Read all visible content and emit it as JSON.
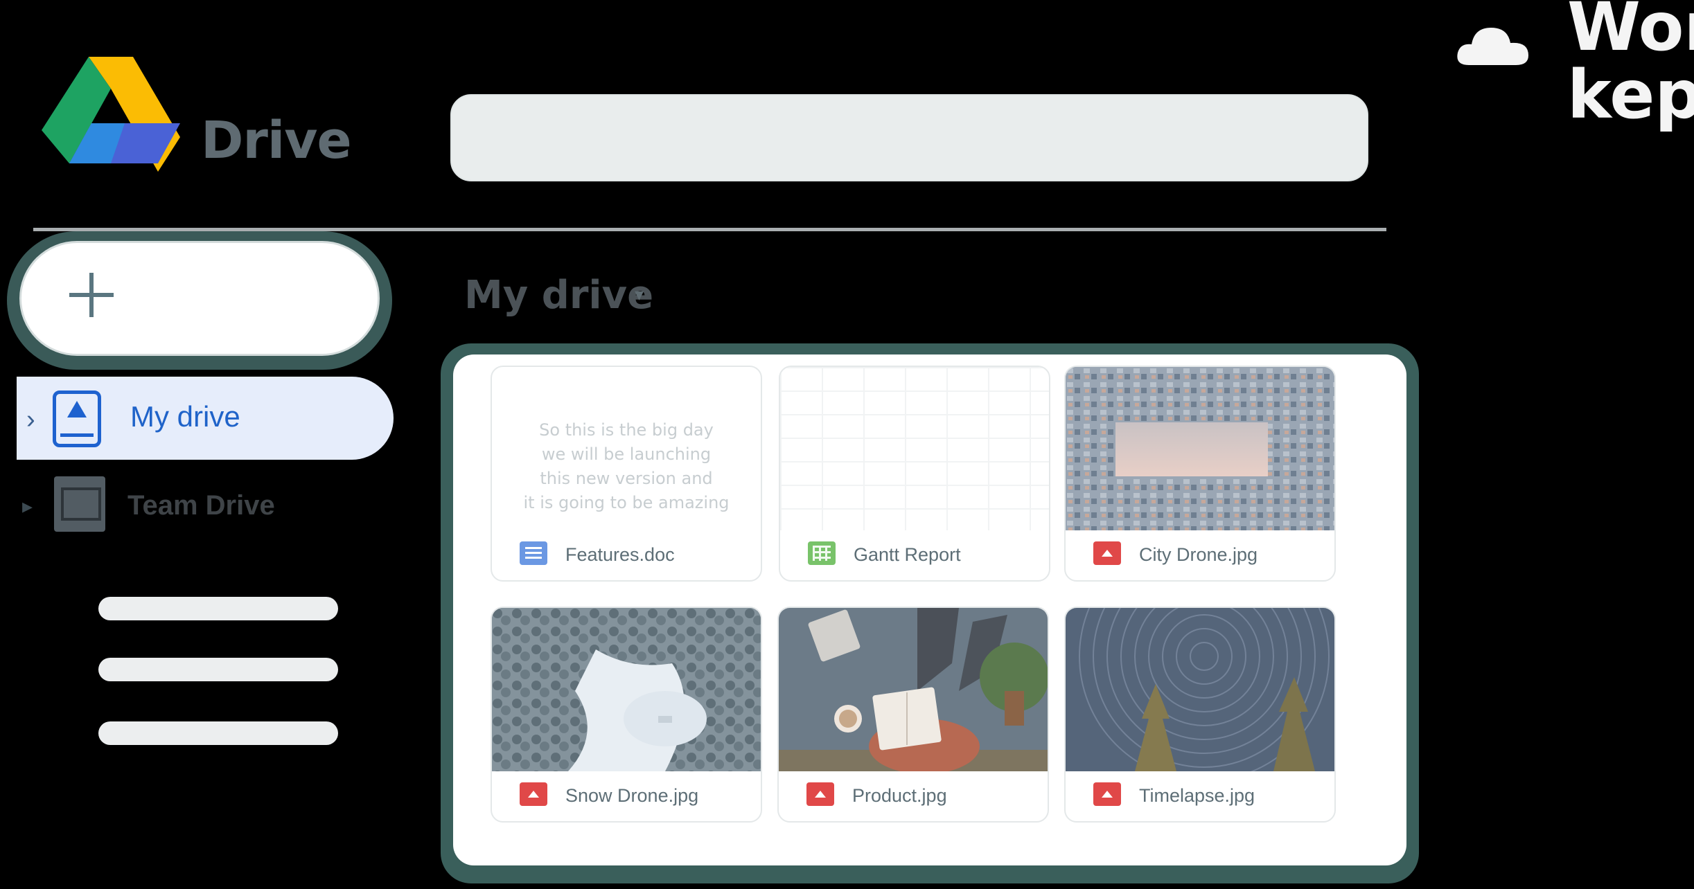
{
  "app": {
    "brand": "Drive",
    "corner_text": "Wor\nkep"
  },
  "search": {
    "placeholder": ""
  },
  "sidebar": {
    "new_button_icon": "plus-icon",
    "items": [
      {
        "label": "My drive",
        "icon": "my-drive-icon",
        "selected": true
      },
      {
        "label": "Team Drive",
        "icon": "team-drive-icon",
        "selected": false
      }
    ]
  },
  "main": {
    "title": "My drive",
    "title_caret": "▾",
    "files": [
      {
        "name": "Features.doc",
        "type": "doc",
        "preview_text": "So this is the big day\nwe will be launching\nthis new version and\nit is going to be amazing"
      },
      {
        "name": "Gantt Report",
        "type": "sheet"
      },
      {
        "name": "City Drone.jpg",
        "type": "image"
      },
      {
        "name": "Snow Drone.jpg",
        "type": "image"
      },
      {
        "name": "Product.jpg",
        "type": "image"
      },
      {
        "name": "Timelapse.jpg",
        "type": "image"
      }
    ]
  },
  "colors": {
    "accent": "#1f63c9",
    "panel_border": "#3a5f5b",
    "selected_bg": "#e6edfb"
  }
}
